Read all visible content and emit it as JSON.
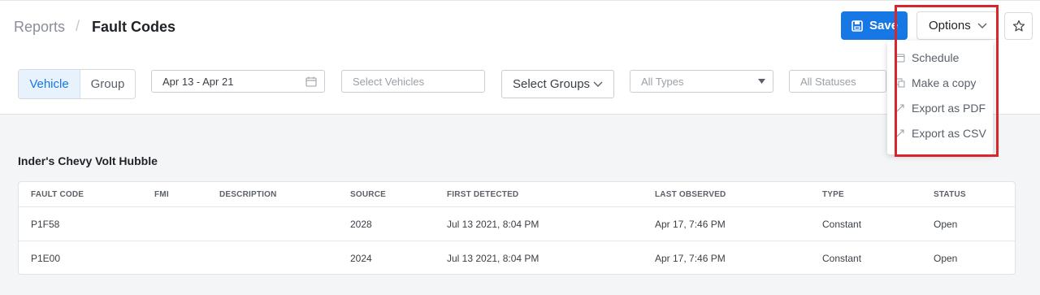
{
  "breadcrumb": {
    "root": "Reports",
    "separator": "/",
    "current": "Fault Codes"
  },
  "toolbar": {
    "save_label": "Save",
    "options_label": "Options"
  },
  "filters": {
    "view_toggle": [
      "Vehicle",
      "Group"
    ],
    "date_range": "Apr 13 - Apr 21",
    "vehicles_placeholder": "Select Vehicles",
    "groups_label": "Select Groups",
    "types_placeholder": "All Types",
    "statuses_placeholder": "All Statuses"
  },
  "options_menu": [
    "Schedule",
    "Make a copy",
    "Export as PDF",
    "Export as CSV"
  ],
  "group_title": "Inder's Chevy Volt Hubble",
  "table": {
    "columns": [
      "FAULT CODE",
      "FMI",
      "DESCRIPTION",
      "SOURCE",
      "FIRST DETECTED",
      "LAST OBSERVED",
      "TYPE",
      "STATUS"
    ],
    "rows": [
      [
        "P1F58",
        "",
        "",
        "2028",
        "Jul 13 2021, 8:04 PM",
        "Apr 17, 7:46 PM",
        "Constant",
        "Open"
      ],
      [
        "P1E00",
        "",
        "",
        "2024",
        "Jul 13 2021, 8:04 PM",
        "Apr 17, 7:46 PM",
        "Constant",
        "Open"
      ]
    ]
  },
  "colors": {
    "accent": "#1677e5",
    "highlight": "#d7262e"
  },
  "icons": [
    "save-icon",
    "chevron-down-icon",
    "star-icon",
    "calendar-icon",
    "caret-down-icon",
    "copy-icon",
    "export-icon"
  ]
}
